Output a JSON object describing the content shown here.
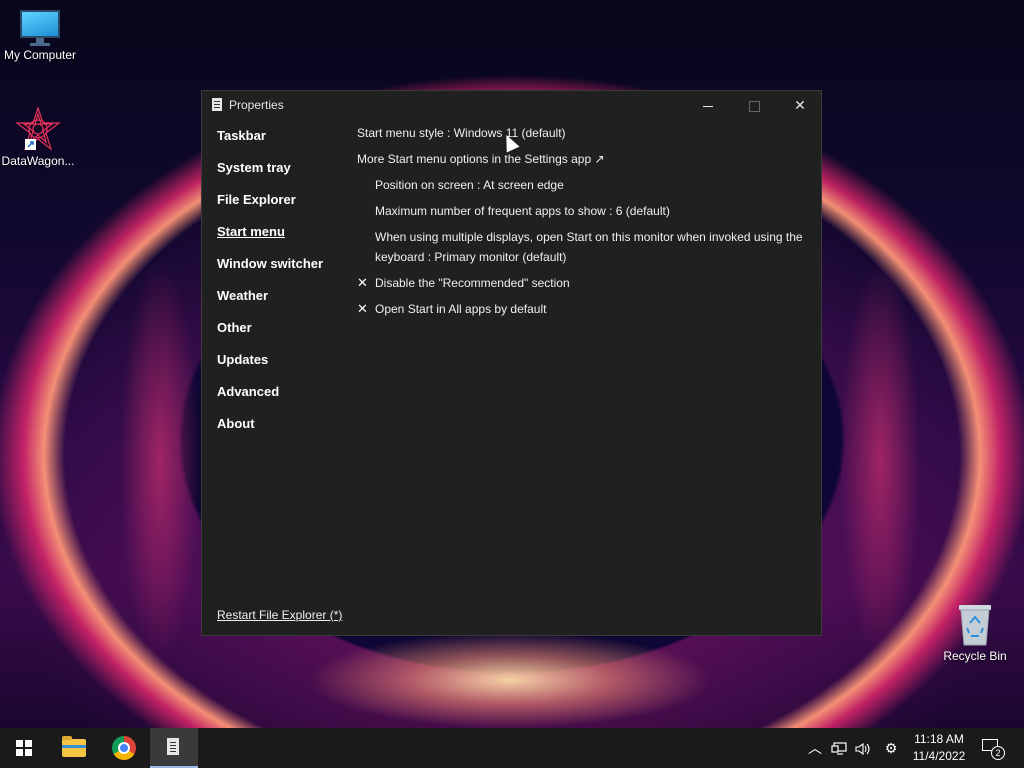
{
  "desktop": {
    "icons": [
      {
        "label": "My Computer",
        "icon": "monitor-icon"
      },
      {
        "label": "DataWagon...",
        "icon": "datawagon-icon"
      },
      {
        "label": "Recycle Bin",
        "icon": "recycle-bin-icon"
      }
    ]
  },
  "window": {
    "title": "Properties",
    "buttons": {
      "minimize": "—",
      "maximize": "☐",
      "close": "✕"
    },
    "nav": [
      {
        "label": "Taskbar",
        "active": false
      },
      {
        "label": "System tray",
        "active": false
      },
      {
        "label": "File Explorer",
        "active": false
      },
      {
        "label": "Start menu",
        "active": true
      },
      {
        "label": "Window switcher",
        "active": false
      },
      {
        "label": "Weather",
        "active": false
      },
      {
        "label": "Other",
        "active": false
      },
      {
        "label": "Updates",
        "active": false
      },
      {
        "label": "Advanced",
        "active": false
      },
      {
        "label": "About",
        "active": false
      }
    ],
    "settings": {
      "start_menu_style": "Start menu style : Windows 11 (default)",
      "more_options": "More Start menu options in the Settings app ↗",
      "position": "Position on screen : At screen edge",
      "max_frequent": "Maximum number of frequent apps to show : 6 (default)",
      "multi_display": "When using multiple displays, open Start on this monitor when invoked using the keyboard : Primary monitor (default)",
      "disable_recommended": "Disable the \"Recommended\" section",
      "open_all_apps": "Open Start in All apps by default",
      "checkmark": "✕"
    },
    "restart_link": "Restart File Explorer (*)"
  },
  "taskbar": {
    "apps": [
      "start-icon",
      "file-explorer-icon",
      "chrome-icon",
      "properties-icon"
    ],
    "tray": {
      "chevron": "︿",
      "network": "🖧",
      "volume": "🔊",
      "gear": "⚙"
    },
    "time": "11:18 AM",
    "date": "11/4/2022",
    "notification_count": "2"
  },
  "colors": {
    "window_bg": "#202020",
    "taskbar_bg": "#1a1a1a",
    "accent": "#9ab8e6"
  }
}
